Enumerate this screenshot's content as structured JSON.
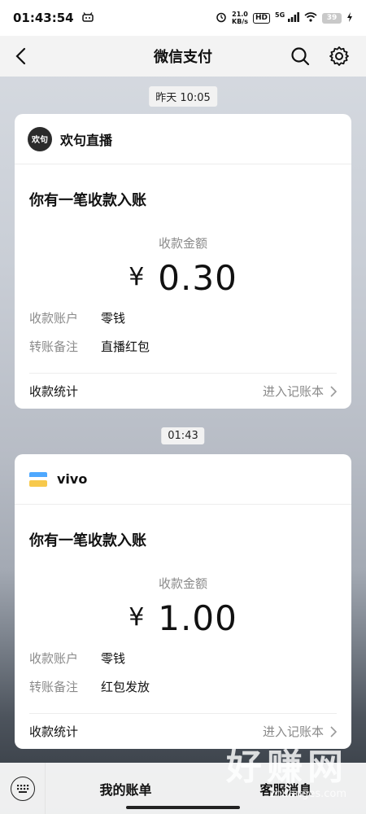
{
  "status_bar": {
    "time": "01:43:54",
    "speed_top": "21.0",
    "speed_bottom": "KB/s",
    "hd_badge": "HD",
    "network": "5G",
    "battery": "39"
  },
  "header": {
    "title": "微信支付"
  },
  "timestamps": [
    "昨天 10:05",
    "01:43"
  ],
  "cards": [
    {
      "merchant": "欢句直播",
      "logo_text": "欢句",
      "title": "你有一笔收款入账",
      "amount_label": "收款金额",
      "currency": "¥",
      "amount": "0.30",
      "rows": [
        {
          "k": "收款账户",
          "v": "零钱"
        },
        {
          "k": "转账备注",
          "v": "直播红包"
        }
      ],
      "foot_left": "收款统计",
      "foot_right": "进入记账本"
    },
    {
      "merchant": "vivo",
      "title": "你有一笔收款入账",
      "amount_label": "收款金额",
      "currency": "¥",
      "amount": "1.00",
      "rows": [
        {
          "k": "收款账户",
          "v": "零钱"
        },
        {
          "k": "转账备注",
          "v": "红包发放"
        }
      ],
      "foot_left": "收款统计",
      "foot_right": "进入记账本"
    }
  ],
  "bottom_bar": {
    "item1": "我的账单",
    "item2": "客服消息"
  },
  "watermark": {
    "main": "好赚网",
    "sub": "zhuanges.com"
  },
  "colors": {
    "vivo_wallet_top": "#4fa8ff",
    "vivo_wallet_bottom": "#f7c94c"
  }
}
